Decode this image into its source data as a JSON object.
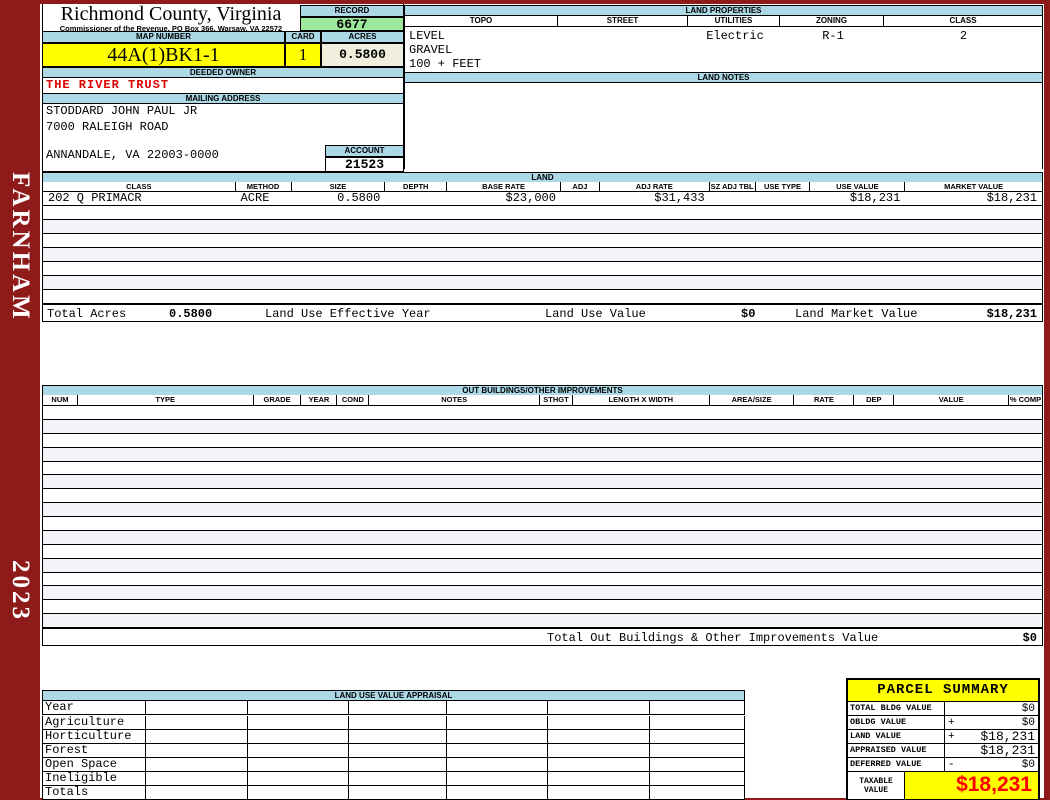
{
  "sidebar": {
    "district": "FARNHAM",
    "year": "2023"
  },
  "header": {
    "county": "Richmond County, Virginia",
    "subtitle": "Commissioner of the Revenue, PO Box 366, Warsaw, VA 22572",
    "record_label": "RECORD",
    "record_value": "6677",
    "map_number_label": "MAP NUMBER",
    "map_number": "44A(1)BK1-1",
    "card_label": "CARD",
    "card": "1",
    "acres_label": "ACRES",
    "acres": "0.5800",
    "deeded_owner_label": "DEEDED OWNER",
    "deeded_owner": "THE RIVER TRUST",
    "mailing_address_label": "MAILING ADDRESS",
    "address_lines": [
      "STODDARD JOHN PAUL JR",
      "7000 RALEIGH ROAD",
      "",
      "ANNANDALE, VA 22003-0000"
    ],
    "account_label": "ACCOUNT",
    "account": "21523"
  },
  "land_properties": {
    "title": "LAND PROPERTIES",
    "columns": [
      "TOPO",
      "STREET",
      "UTILITIES",
      "ZONING",
      "CLASS"
    ],
    "topo_lines": [
      "LEVEL",
      "GRAVEL",
      "100 + FEET"
    ],
    "street": "",
    "utilities": "Electric",
    "zoning": "R-1",
    "class": "2",
    "notes_label": "LAND NOTES",
    "notes": ""
  },
  "land": {
    "title": "LAND",
    "columns": [
      "CLASS",
      "METHOD",
      "SIZE",
      "DEPTH",
      "BASE RATE",
      "ADJ",
      "ADJ RATE",
      "SZ ADJ TBL",
      "USE TYPE",
      "USE VALUE",
      "MARKET VALUE"
    ],
    "rows": [
      [
        "202 Q PRIMACR",
        "ACRE",
        "0.5800",
        "",
        "$23,000",
        "",
        "$31,433",
        "",
        "",
        "$18,231",
        "$18,231"
      ]
    ],
    "empty_row_count": 7,
    "totals": {
      "total_acres_label": "Total Acres",
      "total_acres": "0.5800",
      "effective_year_label": "Land Use Effective Year",
      "use_value_label": "Land Use Value",
      "use_value": "$0",
      "market_value_label": "Land Market Value",
      "market_value": "$18,231"
    }
  },
  "out_buildings": {
    "title": "OUT BUILDINGS/OTHER IMPROVEMENTS",
    "columns": [
      "NUM",
      "TYPE",
      "GRADE",
      "YEAR",
      "COND",
      "NOTES",
      "STHGT",
      "LENGTH X WIDTH",
      "AREA/SIZE",
      "RATE",
      "DEP",
      "VALUE",
      "% COMP"
    ],
    "empty_row_count": 16,
    "total_label": "Total Out Buildings & Other Improvements Value",
    "total_value": "$0"
  },
  "land_use_appraisal": {
    "title": "LAND USE VALUE APPRAISAL",
    "row_labels": [
      "Year",
      "Agriculture",
      "Horticulture",
      "Forest",
      "Open Space",
      "Ineligible",
      "Totals"
    ],
    "column_count": 6
  },
  "parcel_summary": {
    "title": "PARCEL SUMMARY",
    "rows": [
      {
        "label": "TOTAL BLDG VALUE",
        "op": "",
        "value": "$0"
      },
      {
        "label": "OBLDG VALUE",
        "op": "+",
        "value": "$0"
      },
      {
        "label": "LAND VALUE",
        "op": "+",
        "value": "$18,231"
      },
      {
        "label": "APPRAISED VALUE",
        "op": "",
        "value": "$18,231"
      },
      {
        "label": "DEFERRED VALUE",
        "op": "-",
        "value": "$0"
      }
    ],
    "taxable_label": "TAXABLE VALUE",
    "taxable_value": "$18,231"
  },
  "colors": {
    "maroon": "#8E1A1A",
    "header_blue": "#ADD8E6",
    "record_green": "#9CE89C",
    "highlight_yellow": "#FFFF00",
    "acres_cream": "#F0EEDC",
    "owner_red": "#DD0000",
    "taxable_red": "#FF0000"
  }
}
